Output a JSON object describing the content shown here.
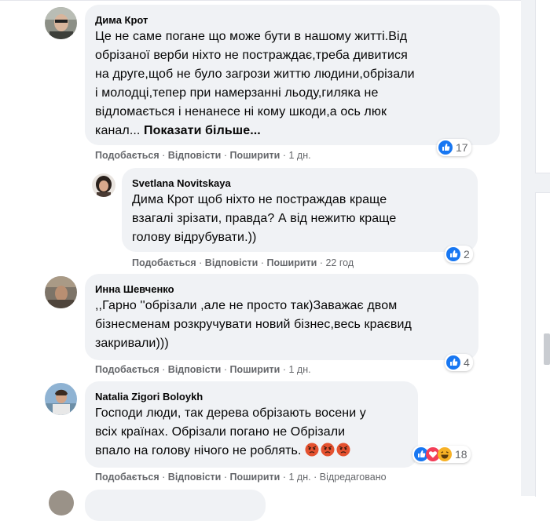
{
  "comments": [
    {
      "author": "Дима Крот",
      "lines": [
        "Це не саме погане що може бути в нашому житті.Від",
        "обрізаної верби ніхто не постраждає,треба дивитися",
        "на друге,щоб не було загрози життю людини,обрізали",
        "і молодці,тепер при намерзанні льоду,гиляка не",
        "відломається і ненанесе ні кому шкоди,а ось люк"
      ],
      "last_line": "канал...",
      "see_more": "Показати більше...",
      "like": "Подобається",
      "reply": "Відповісти",
      "share": "Поширити",
      "sep": "·",
      "time": "1 дн.",
      "reactions_count": "17"
    },
    {
      "author": "Svetlana Novitskaya",
      "tag": "Дима Крот",
      "first_line_rest": " щоб ніхто не постраждав краще",
      "lines": [
        "взагалі зрізати, правда? А від нежитю краще",
        "голову відрубувати.))"
      ],
      "like": "Подобається",
      "reply": "Відповісти",
      "share": "Поширити",
      "sep": "·",
      "time": "22 год",
      "reactions_count": "2"
    },
    {
      "author": "Инна Шевченко",
      "lines": [
        ",,Гарно ''обрізали ,але не просто так)Заважає двом",
        "бізнесменам розкручувати новий бізнес,весь краєвид",
        "закривали)))"
      ],
      "like": "Подобається",
      "reply": "Відповісти",
      "share": "Поширити",
      "sep": "·",
      "time": "1 дн.",
      "reactions_count": "4"
    },
    {
      "author": "Natalia Zigori Boloykh",
      "lines": [
        "Господи люди, так дерева обрізають восени у",
        "всіх країнах. Обрізали погано не Обрізали"
      ],
      "last_line": "впало на голову нічого не роблять.",
      "emojis": [
        "angry-face-emoji",
        "angry-face-emoji",
        "angry-face-emoji"
      ],
      "like": "Подобається",
      "reply": "Відповісти",
      "share": "Поширити",
      "sep": "·",
      "time": "1 дн.",
      "edited": "Відредаговано",
      "reactions_count": "18"
    }
  ],
  "colors": {
    "bubble": "#f0f2f5",
    "like_blue": "#1877f2",
    "love_red": "#f33e58",
    "haha_yellow": "#f7b125",
    "meta_gray": "#65676b"
  }
}
